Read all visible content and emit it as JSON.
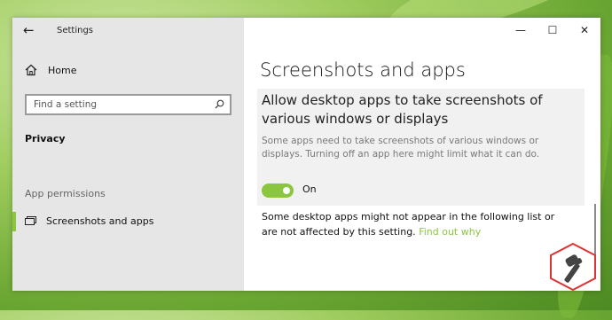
{
  "window": {
    "app_title": "Settings",
    "controls": {
      "minimize": "—",
      "maximize": "☐",
      "close": "✕"
    }
  },
  "sidebar": {
    "home_label": "Home",
    "search_placeholder": "Find a setting",
    "section_title": "Privacy",
    "group_label": "App permissions",
    "items": [
      {
        "label": "Screenshots and apps",
        "selected": true
      }
    ]
  },
  "main": {
    "page_title": "Screenshots and apps",
    "heading": "Allow desktop apps to take screenshots of various windows or displays",
    "description": "Some apps need to take screenshots of various windows or displays. Turning off an app here might limit what it can do.",
    "toggle": {
      "state": "On",
      "on": true
    },
    "note": "Some desktop apps might not appear in the following list or are not affected by this setting.",
    "link": "Find out why"
  },
  "colors": {
    "accent": "#8cc63f",
    "sidebar_bg": "#e6e6e6",
    "panel_bg": "#f1f1f1"
  },
  "icons": [
    "back-arrow-icon",
    "home-icon",
    "search-icon",
    "screenshot-monitor-icon",
    "minimize-icon",
    "maximize-icon",
    "close-icon",
    "windows-logo-icon"
  ]
}
